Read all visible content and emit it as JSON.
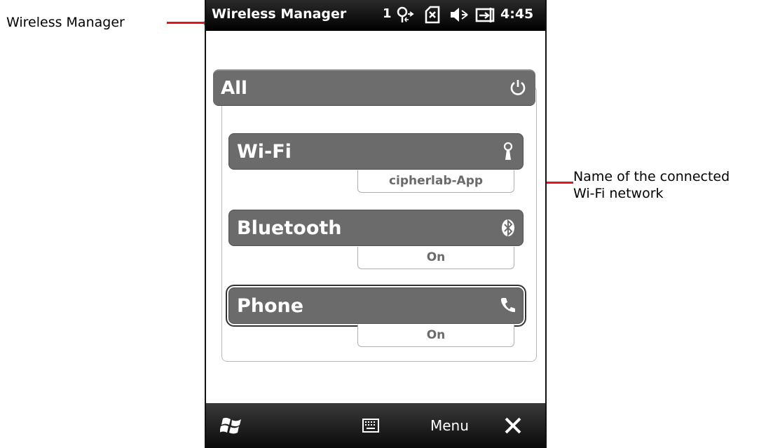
{
  "callouts": {
    "wireless_manager": "Wireless Manager",
    "network_name_line1": "Name of the connected",
    "network_name_line2": "Wi-Fi network"
  },
  "status_bar": {
    "title": "Wireless Manager",
    "signal_count": "1",
    "time": "4:45"
  },
  "sections": {
    "all": {
      "label": "All"
    },
    "wifi": {
      "label": "Wi-Fi",
      "status": "cipherlab-App"
    },
    "bluetooth": {
      "label": "Bluetooth",
      "status": "On"
    },
    "phone": {
      "label": "Phone",
      "status": "On"
    }
  },
  "bottom_bar": {
    "menu_label": "Menu"
  },
  "colors": {
    "accent_red": "#e8141b",
    "bar_gray": "#6b6b6b"
  },
  "icons": [
    "windows-start-icon",
    "keyboard-icon",
    "close-icon",
    "power-icon",
    "wifi-antenna-icon",
    "bluetooth-icon",
    "phone-icon",
    "connectivity-icon",
    "no-sim-icon",
    "speaker-mute-icon",
    "battery-charging-icon"
  ]
}
